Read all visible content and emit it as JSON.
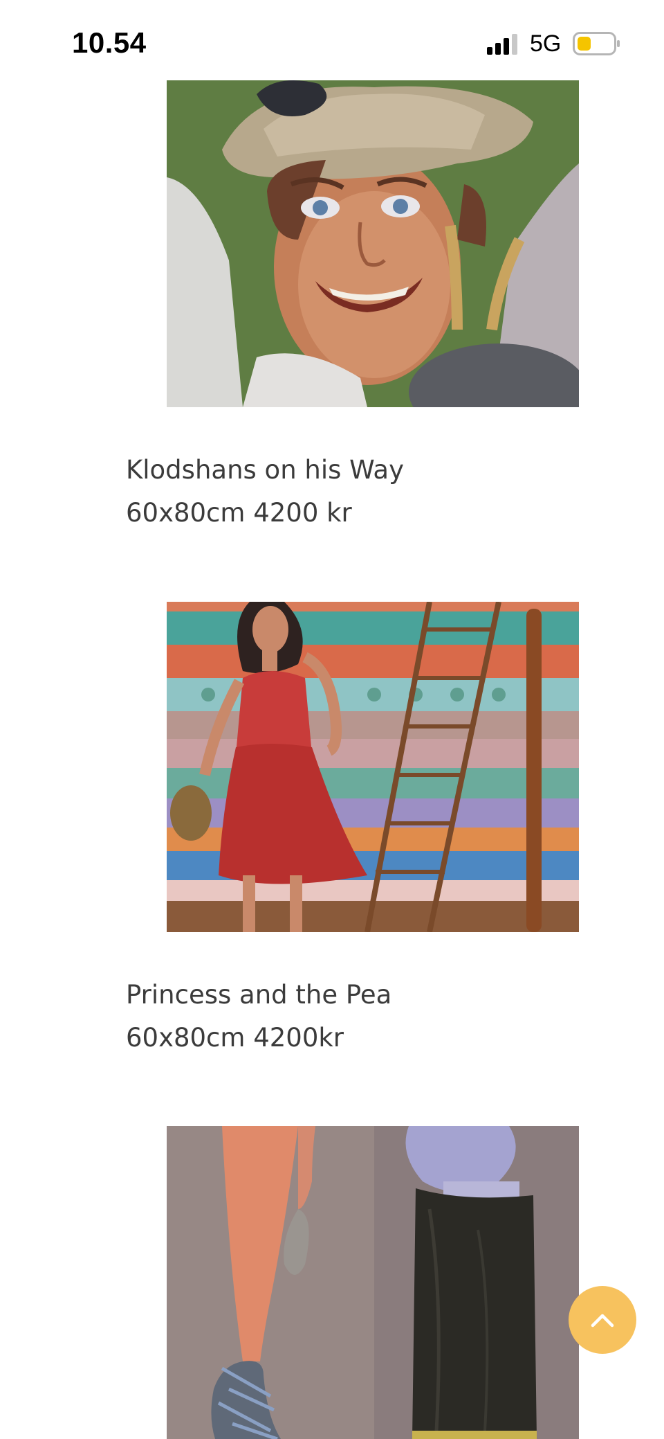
{
  "status_bar": {
    "time": "10.54",
    "network": "5G",
    "signal_icon": "cellular-signal-icon",
    "battery_icon": "battery-low-icon",
    "battery_color": "#f5c400"
  },
  "gallery": {
    "items": [
      {
        "image_icon": "painting-boy-with-hat-and-goat",
        "title": "Klodshans on his Way",
        "details": "60x80cm 4200 kr"
      },
      {
        "image_icon": "painting-princess-on-mattresses",
        "title": "Princess and the Pea",
        "details": "60x80cm 4200kr"
      },
      {
        "image_icon": "painting-dancer-legs-and-boot"
      }
    ]
  },
  "scroll_top": {
    "icon": "chevron-up-icon",
    "color": "#f7c25e"
  }
}
